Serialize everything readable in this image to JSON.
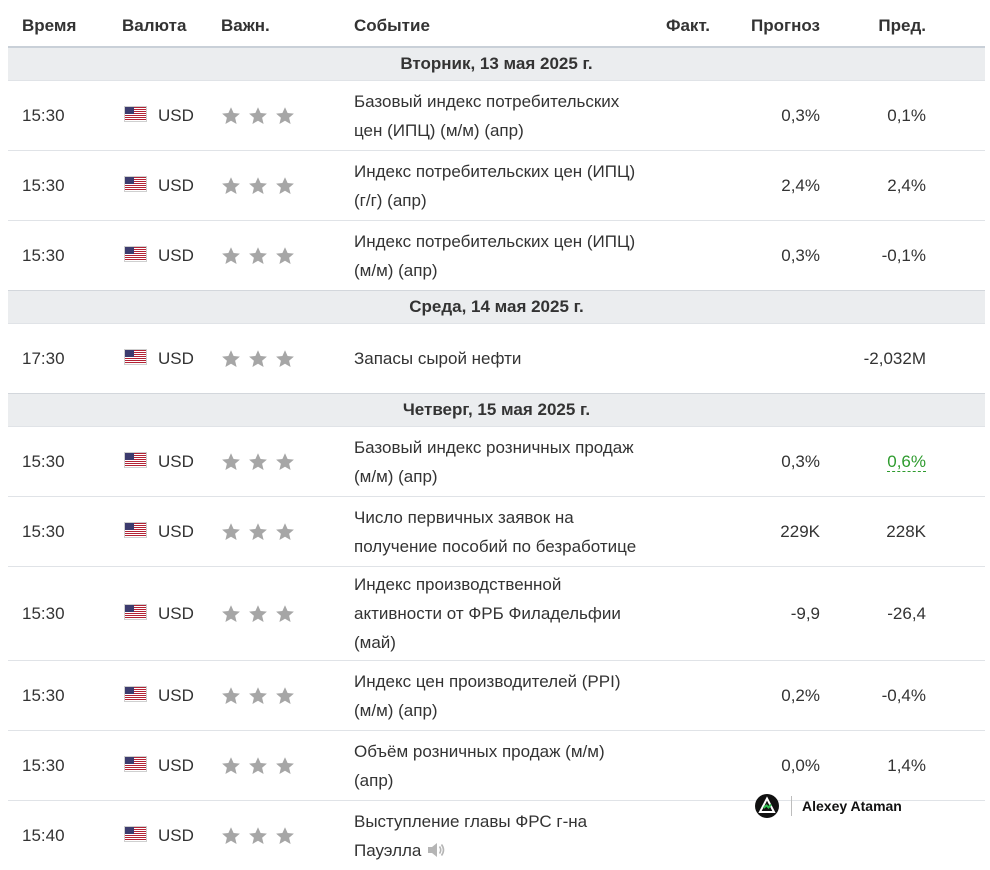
{
  "header": {
    "time": "Время",
    "currency": "Валюта",
    "importance": "Важн.",
    "event": "Событие",
    "actual": "Факт.",
    "forecast": "Прогноз",
    "previous": "Пред."
  },
  "days": [
    {
      "label": "Вторник, 13 мая 2025 г.",
      "events": [
        {
          "time": "15:30",
          "currency": "USD",
          "stars": 3,
          "event": "Базовый индекс потребительских цен (ИПЦ) (м/м) (апр)",
          "actual": "",
          "forecast": "0,3%",
          "previous": "0,1%"
        },
        {
          "time": "15:30",
          "currency": "USD",
          "stars": 3,
          "event": "Индекс потребительских цен (ИПЦ) (г/г) (апр)",
          "actual": "",
          "forecast": "2,4%",
          "previous": "2,4%"
        },
        {
          "time": "15:30",
          "currency": "USD",
          "stars": 3,
          "event": "Индекс потребительских цен (ИПЦ) (м/м) (апр)",
          "actual": "",
          "forecast": "0,3%",
          "previous": "-0,1%"
        }
      ]
    },
    {
      "label": "Среда, 14 мая 2025 г.",
      "events": [
        {
          "time": "17:30",
          "currency": "USD",
          "stars": 3,
          "event": "Запасы сырой нефти",
          "actual": "",
          "forecast": "",
          "previous": "-2,032M"
        }
      ]
    },
    {
      "label": "Четверг, 15 мая 2025 г.",
      "events": [
        {
          "time": "15:30",
          "currency": "USD",
          "stars": 3,
          "event": "Базовый индекс розничных продаж (м/м) (апр)",
          "actual": "",
          "forecast": "0,3%",
          "previous": "0,6%",
          "previous_color": "#2e9b2e"
        },
        {
          "time": "15:30",
          "currency": "USD",
          "stars": 3,
          "event": "Число первичных заявок на получение пособий по безработице",
          "actual": "",
          "forecast": "229K",
          "previous": "228K"
        },
        {
          "time": "15:30",
          "currency": "USD",
          "stars": 3,
          "event": "Индекс производственной активности от ФРБ Филадельфии (май)",
          "actual": "",
          "forecast": "-9,9",
          "previous": "-26,4"
        },
        {
          "time": "15:30",
          "currency": "USD",
          "stars": 3,
          "event": "Индекс цен производителей (PPI) (м/м) (апр)",
          "actual": "",
          "forecast": "0,2%",
          "previous": "-0,4%"
        },
        {
          "time": "15:30",
          "currency": "USD",
          "stars": 3,
          "event": "Объём розничных продаж (м/м) (апр)",
          "actual": "",
          "forecast": "0,0%",
          "previous": "1,4%"
        },
        {
          "time": "15:40",
          "currency": "USD",
          "stars": 3,
          "event": "Выступление главы ФРС г-на Пауэлла",
          "actual": "",
          "forecast": "",
          "previous": "",
          "has_sound": true
        }
      ]
    }
  ],
  "icons": {
    "flag": "us-flag-icon",
    "star": "star-icon",
    "sound": "speaker-icon"
  },
  "colors": {
    "star": "#a6a6a6",
    "positive": "#2e9b2e",
    "day_bg": "#ebedef"
  },
  "watermark": {
    "text": "Alexey Ataman",
    "logo": "triangle-logo-icon"
  }
}
